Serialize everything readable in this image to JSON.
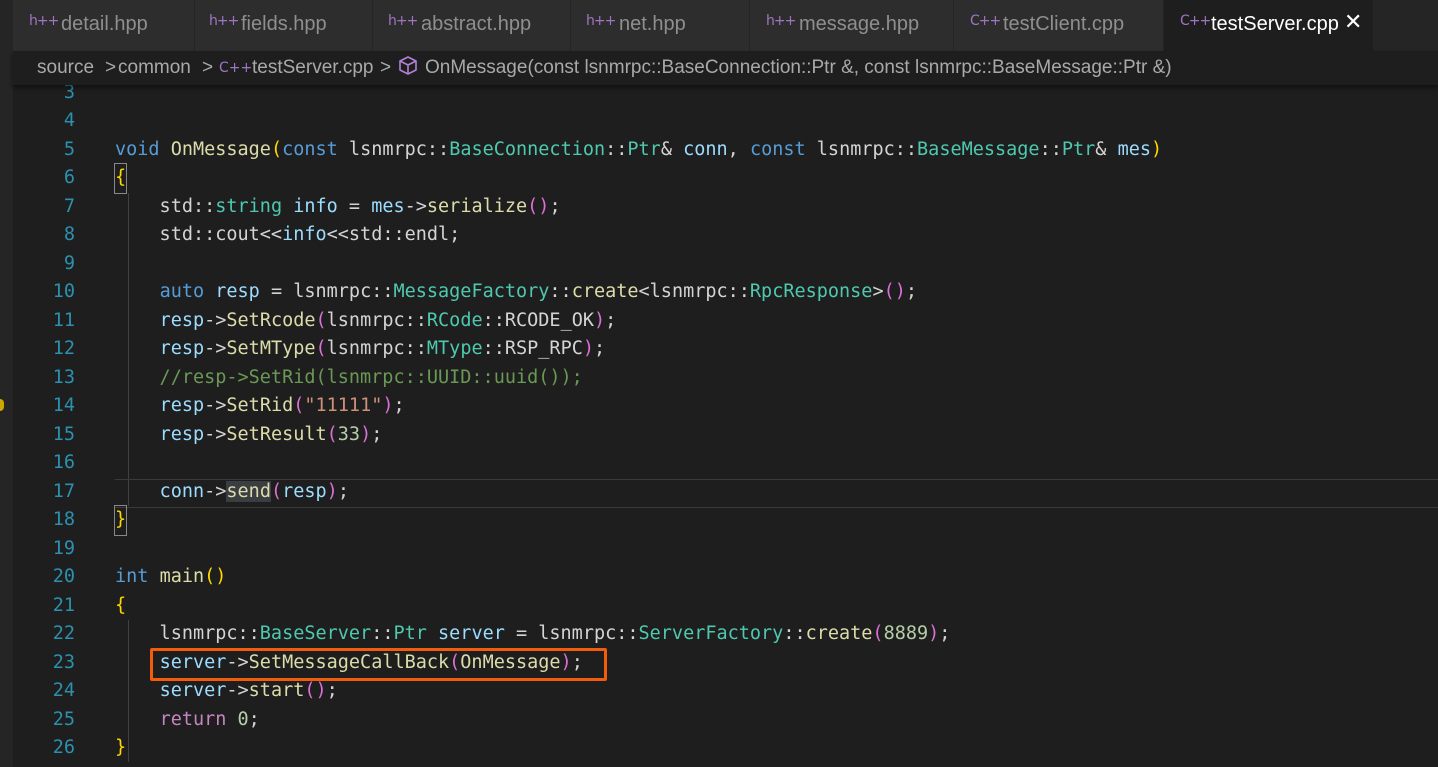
{
  "tabs": [
    {
      "icon": "h++",
      "label": "detail.hpp"
    },
    {
      "icon": "h++",
      "label": "fields.hpp"
    },
    {
      "icon": "h++",
      "label": "abstract.hpp"
    },
    {
      "icon": "h++",
      "label": "net.hpp"
    },
    {
      "icon": "h++",
      "label": "message.hpp"
    },
    {
      "icon": "C++",
      "label": "testClient.cpp"
    },
    {
      "icon": "C++",
      "label": "testServer.cpp",
      "active": true
    }
  ],
  "close_glyph": "✕",
  "breadcrumb": {
    "items": [
      "source",
      "common",
      "testServer.cpp",
      "OnMessage(const lsnmrpc::BaseConnection::Ptr &, const lsnmrpc::BaseMessage::Ptr &)"
    ],
    "separator": ">",
    "file_icon": "C++",
    "symbol_icon": "cube-icon"
  },
  "code_lines": [
    {
      "n": "3",
      "code": ""
    },
    {
      "n": "4",
      "code": ""
    },
    {
      "n": "5",
      "code": "void OnMessage(const lsnmrpc::BaseConnection::Ptr& conn, const lsnmrpc::BaseMessage::Ptr& mes)"
    },
    {
      "n": "6",
      "code": "{"
    },
    {
      "n": "7",
      "code": "    std::string info = mes->serialize();"
    },
    {
      "n": "8",
      "code": "    std::cout<<info<<std::endl;"
    },
    {
      "n": "9",
      "code": ""
    },
    {
      "n": "10",
      "code": "    auto resp = lsnmrpc::MessageFactory::create<lsnmrpc::RpcResponse>();"
    },
    {
      "n": "11",
      "code": "    resp->SetRcode(lsnmrpc::RCode::RCODE_OK);"
    },
    {
      "n": "12",
      "code": "    resp->SetMType(lsnmrpc::MType::RSP_RPC);"
    },
    {
      "n": "13",
      "code": "    //resp->SetRid(lsnmrpc::UUID::uuid());"
    },
    {
      "n": "14",
      "code": "    resp->SetRid(\"11111\");"
    },
    {
      "n": "15",
      "code": "    resp->SetResult(33);"
    },
    {
      "n": "16",
      "code": ""
    },
    {
      "n": "17",
      "code": "    conn->send(resp);"
    },
    {
      "n": "18",
      "code": "}"
    },
    {
      "n": "19",
      "code": ""
    },
    {
      "n": "20",
      "code": "int main()"
    },
    {
      "n": "21",
      "code": "{"
    },
    {
      "n": "22",
      "code": "    lsnmrpc::BaseServer::Ptr server = lsnmrpc::ServerFactory::create(8889);"
    },
    {
      "n": "23",
      "code": "    server->SetMessageCallBack(OnMessage);"
    },
    {
      "n": "24",
      "code": "    server->start();"
    },
    {
      "n": "25",
      "code": "    return 0;"
    },
    {
      "n": "26",
      "code": "}"
    }
  ],
  "colors": {
    "highlight_box": "#f25d0c",
    "keyword": "#569cd6",
    "type": "#4ec9b0",
    "function": "#dcdcaa",
    "comment": "#6a9955",
    "string": "#ce9178",
    "number": "#b5cea8",
    "line_number": "#2b91af"
  }
}
